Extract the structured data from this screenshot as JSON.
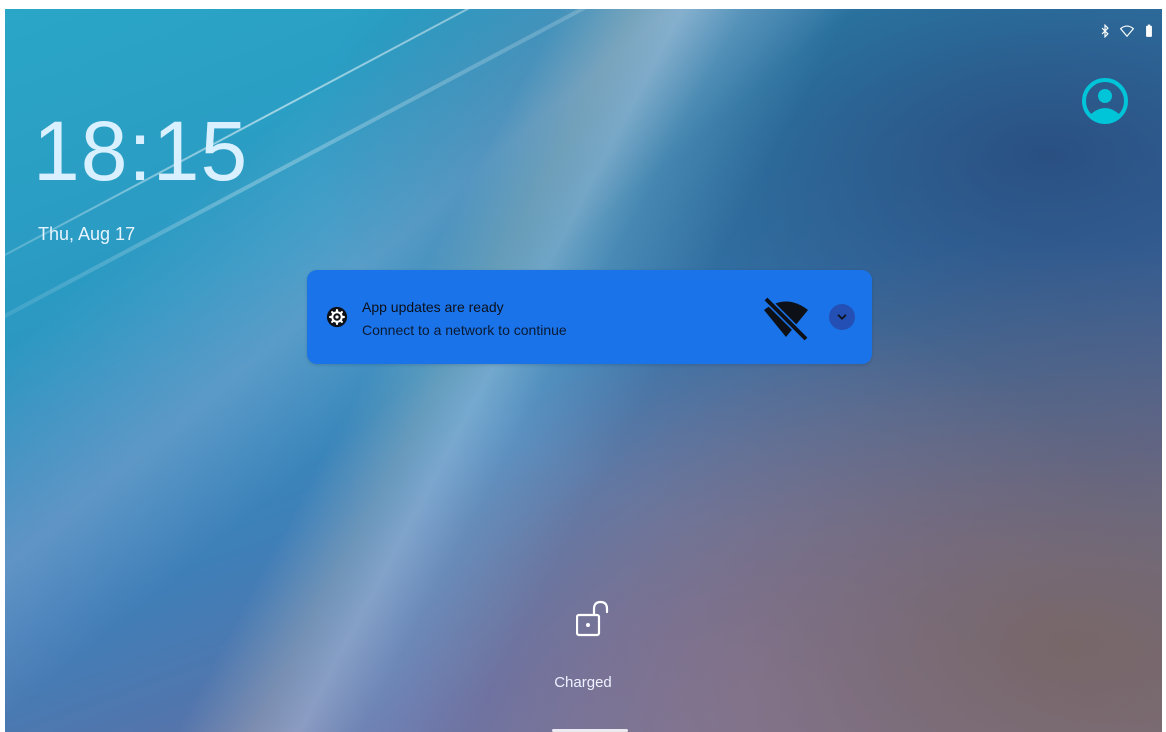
{
  "status_bar": {
    "bluetooth_icon": "bluetooth-icon",
    "wifi_icon": "wifi-icon",
    "battery_icon": "battery-icon"
  },
  "lock_screen": {
    "time": "18:15",
    "date": "Thu, Aug 17",
    "status": "Charged",
    "user_icon": "account-circle-icon",
    "lock_icon": "unlock-icon"
  },
  "notification": {
    "title": "App updates are ready",
    "text": "Connect to a network to continue",
    "app_icon": "gear-icon",
    "large_icon": "wifi-off-icon",
    "expand_icon": "chevron-down-icon"
  },
  "colors": {
    "notification_bg": "#1a73e8",
    "avatar": "#00c4d8"
  }
}
